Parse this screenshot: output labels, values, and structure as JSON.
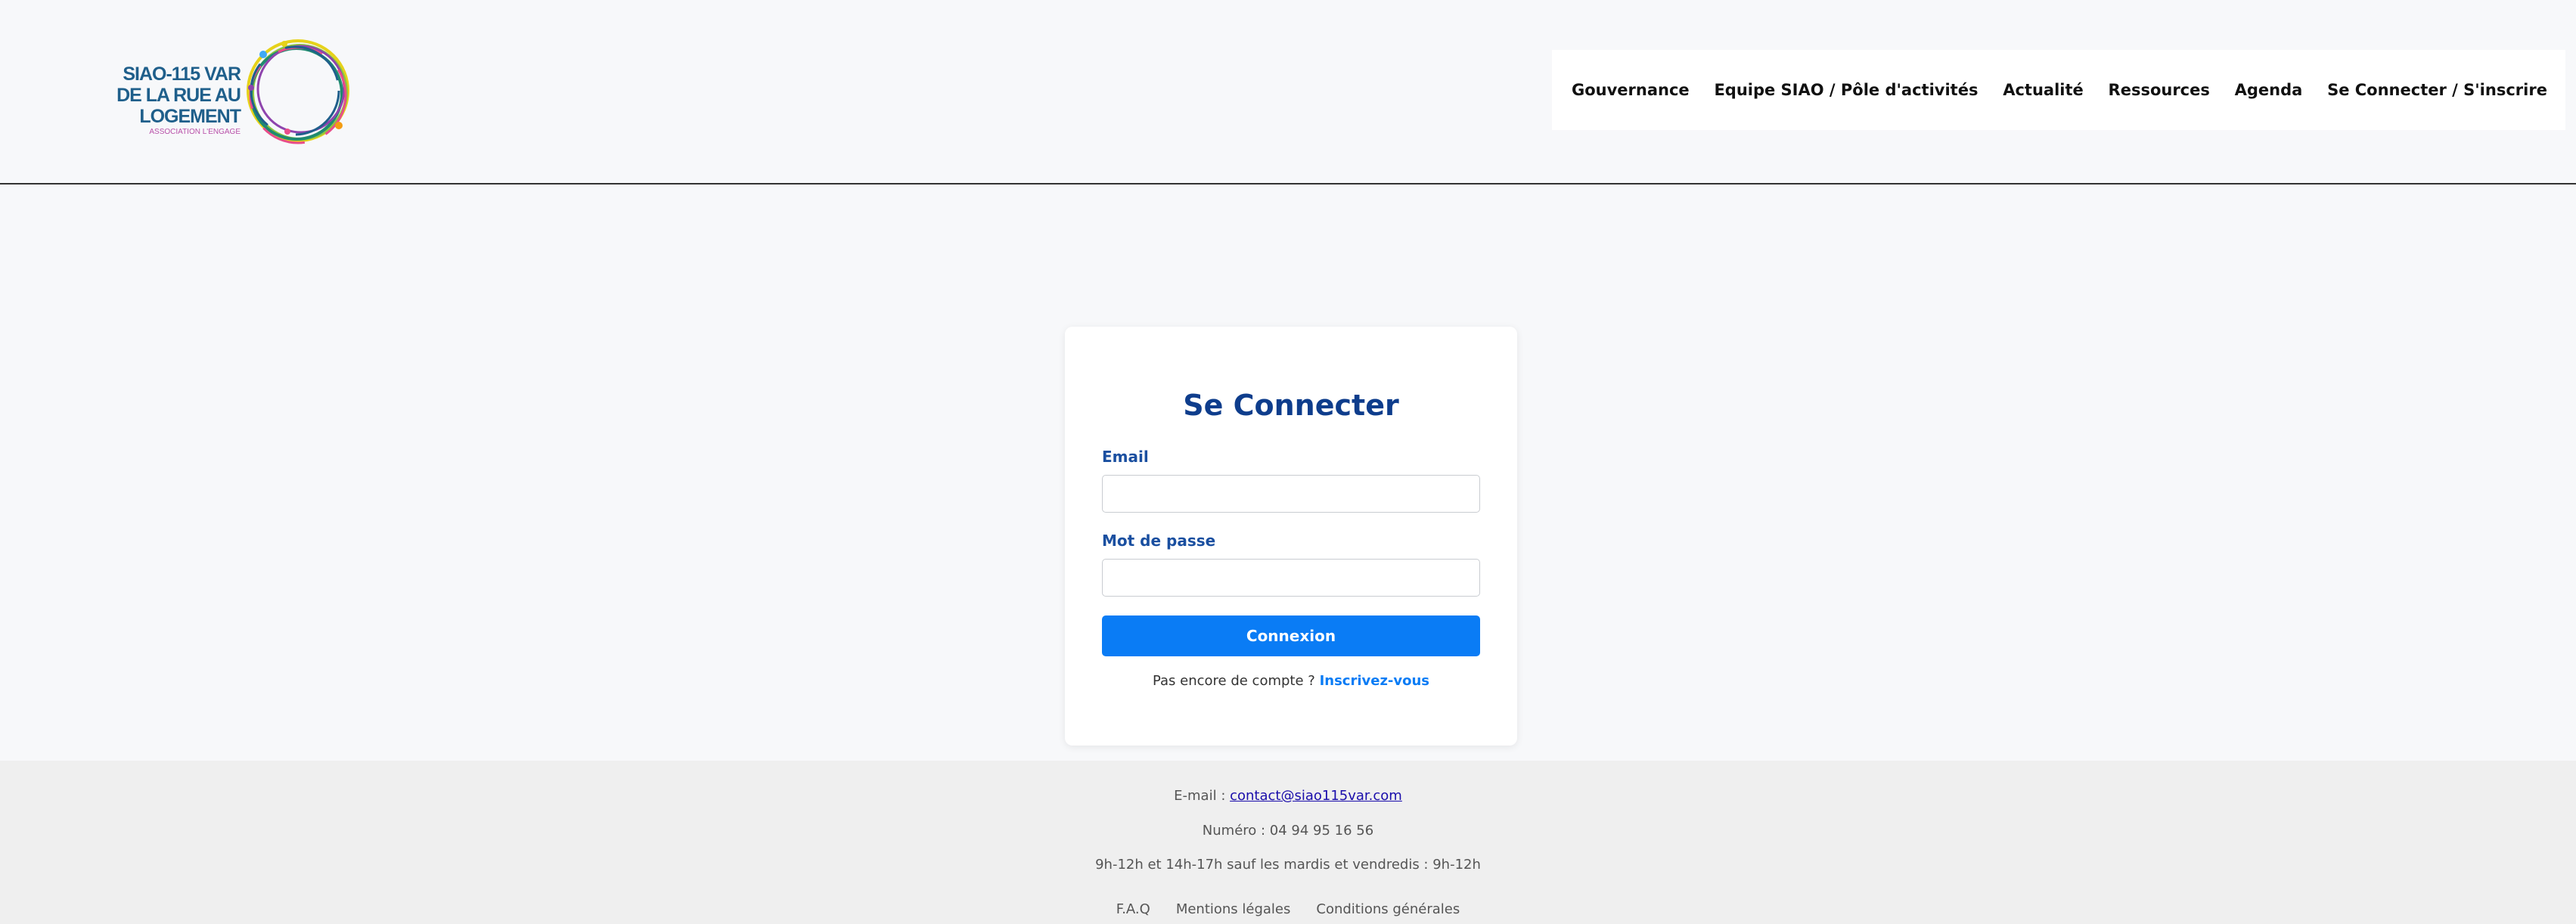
{
  "logo": {
    "line1": "SIAO-115 VAR",
    "line2": "DE LA RUE AU LOGEMENT",
    "line3": "ASSOCIATION L'ENGAGE"
  },
  "nav": {
    "items": [
      {
        "label": "Gouvernance"
      },
      {
        "label": "Equipe SIAO / Pôle d'activités"
      },
      {
        "label": "Actualité"
      },
      {
        "label": "Ressources"
      },
      {
        "label": "Agenda"
      },
      {
        "label": "Se Connecter / S'inscrire"
      }
    ]
  },
  "login": {
    "title": "Se Connecter",
    "email_label": "Email",
    "email_value": "",
    "password_label": "Mot de passe",
    "password_value": "",
    "submit_label": "Connexion",
    "signup_prompt": "Pas encore de compte ? ",
    "signup_link": "Inscrivez-vous"
  },
  "footer": {
    "email_prefix": "E-mail : ",
    "email": "contact@siao115var.com",
    "phone": "Numéro : 04 94 95 16 56",
    "hours": "9h-12h et 14h-17h sauf les mardis et vendredis : 9h-12h",
    "links": [
      "F.A.Q",
      "Mentions légales",
      "Conditions générales"
    ]
  },
  "colors": {
    "accent": "#0a7cf5",
    "title": "#0e3d8c",
    "label": "#1a4fa0",
    "page_bg": "#f7f8fa",
    "footer_bg": "#efefef"
  }
}
